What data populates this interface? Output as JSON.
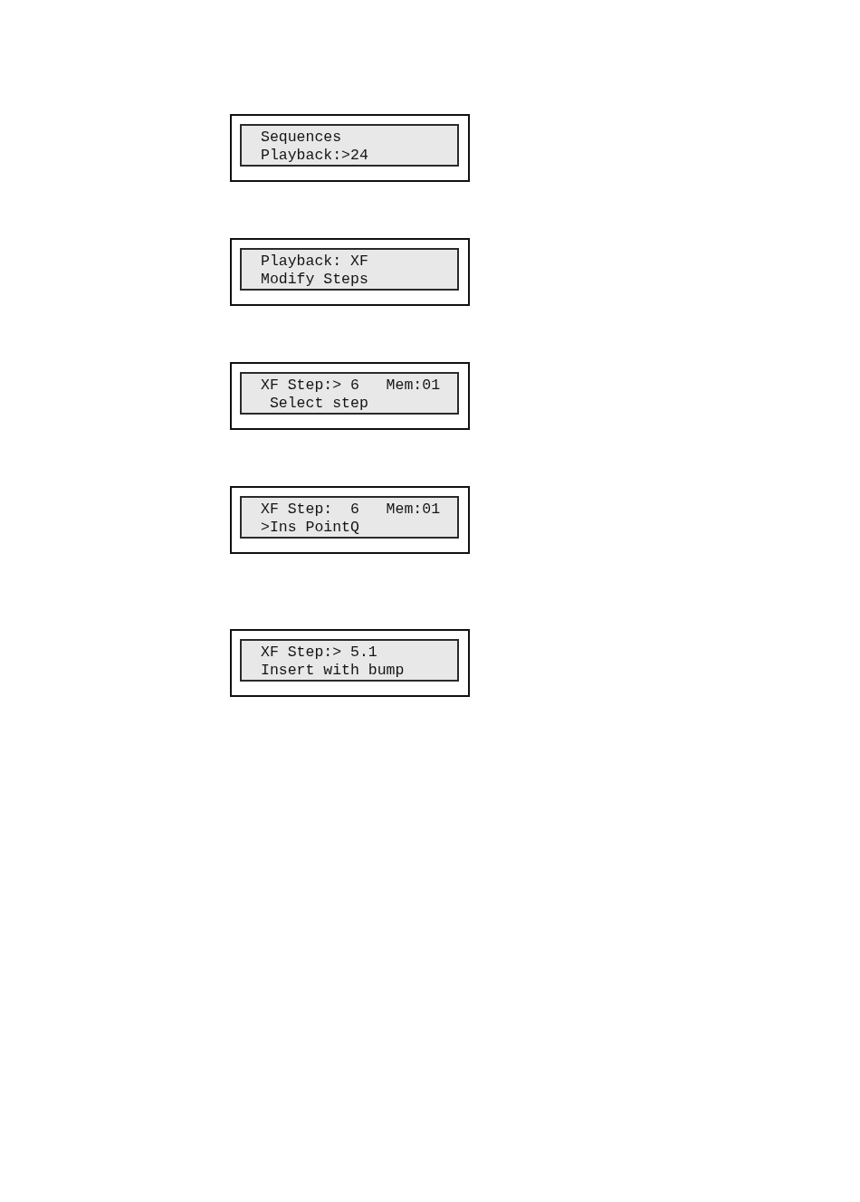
{
  "displays": [
    {
      "lines": [
        "Sequences",
        "Playback:>24"
      ]
    },
    {
      "lines": [
        "Playback: XF",
        "Modify Steps"
      ]
    },
    {
      "lines": [
        "XF Step:> 6   Mem:01",
        " Select step"
      ]
    },
    {
      "lines": [
        "XF Step:  6   Mem:01",
        ">Ins PointQ"
      ]
    },
    {
      "lines": [
        "XF Step:> 5.1",
        "Insert with bump"
      ]
    }
  ]
}
